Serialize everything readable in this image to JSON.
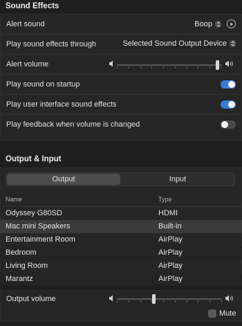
{
  "sound_effects": {
    "title": "Sound Effects",
    "alert_sound": {
      "label": "Alert sound",
      "value": "Boop",
      "stepper_icon": "⌃"
    },
    "play_through": {
      "label": "Play sound effects through",
      "value": "Selected Sound Output Device"
    },
    "alert_volume": {
      "label": "Alert volume",
      "level": 0.97
    },
    "startup": {
      "label": "Play sound on startup",
      "on": true
    },
    "ui_sounds": {
      "label": "Play user interface sound effects",
      "on": true
    },
    "feedback": {
      "label": "Play feedback when volume is changed",
      "on": false
    }
  },
  "output_input": {
    "title": "Output & Input",
    "tabs": [
      {
        "label": "Output",
        "active": true
      },
      {
        "label": "Input",
        "active": false
      }
    ],
    "columns": {
      "name": "Name",
      "type": "Type"
    },
    "devices": [
      {
        "name": "Odyssey G80SD",
        "type": "HDMI",
        "selected": false
      },
      {
        "name": "Mac mini Speakers",
        "type": "Built-in",
        "selected": true
      },
      {
        "name": "Entertainment Room",
        "type": "AirPlay",
        "selected": false
      },
      {
        "name": "Bedroom",
        "type": "AirPlay",
        "selected": false
      },
      {
        "name": "Living Room",
        "type": "AirPlay",
        "selected": false
      },
      {
        "name": "Marantz",
        "type": "AirPlay",
        "selected": false
      }
    ],
    "output_volume": {
      "label": "Output volume",
      "level": 0.35
    },
    "mute": {
      "label": "Mute",
      "checked": false
    }
  },
  "colors": {
    "accent": "#3a7bd5",
    "background": "#1e1e1e"
  }
}
